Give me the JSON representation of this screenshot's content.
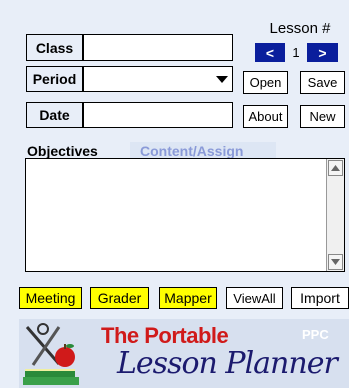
{
  "header": {
    "lesson_label": "Lesson #",
    "lesson_number": "1",
    "prev": "<",
    "next": ">"
  },
  "fields": {
    "class_label": "Class",
    "period_label": "Period",
    "date_label": "Date",
    "class_value": "",
    "period_value": "",
    "date_value": ""
  },
  "buttons": {
    "open": "Open",
    "save": "Save",
    "about": "About",
    "new": "New"
  },
  "tabs": {
    "objectives": "Objectives",
    "content": "Content/Assign"
  },
  "bottom_buttons": {
    "meeting": "Meeting",
    "grader": "Grader",
    "mapper": "Mapper",
    "viewall": "ViewAll",
    "import": "Import"
  },
  "logo": {
    "the_portable": "The Portable",
    "ppc": "PPC",
    "lesson_planner": "Lesson Planner"
  },
  "colors": {
    "background": "#e8eef8",
    "nav_blue": "#0a1e9c",
    "yellow": "#ffff00",
    "tab_active": "#e8eef8",
    "tab_inactive": "#dde6f4",
    "logo_red": "#d01a1a",
    "logo_navy": "#1b1a6e"
  }
}
